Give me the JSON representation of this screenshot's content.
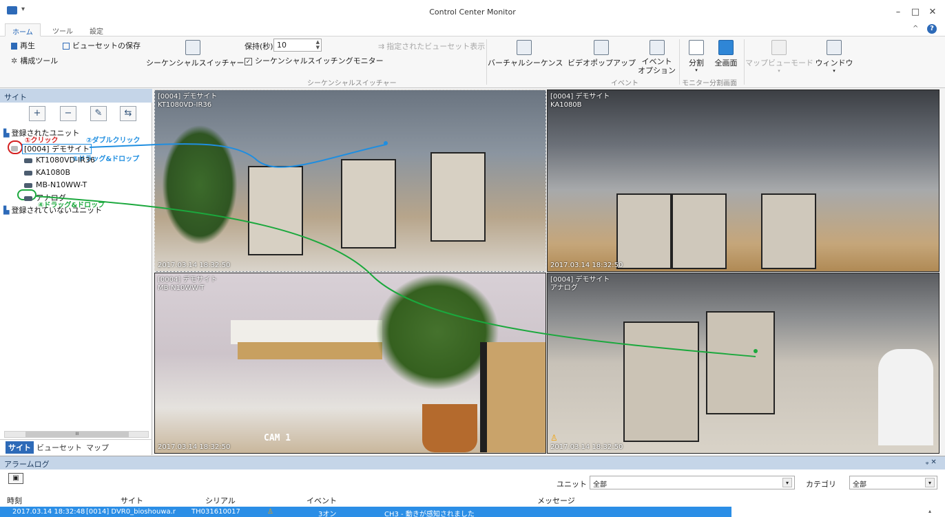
{
  "window": {
    "title": "Control Center Monitor",
    "minimize": "–",
    "maximize": "□",
    "close": "✕",
    "collapse": "^",
    "help": "?"
  },
  "tabs": [
    "ホーム",
    "ツール",
    "設定"
  ],
  "ribbon": {
    "play": "再生",
    "save_viewset": "ビューセットの保存",
    "config_tool": "構成ツール",
    "sequential_switcher": "シーケンシャルスイッチャー",
    "hold_label": "保持(秒)",
    "hold_value": "10",
    "seq_monitor": "シーケンシャルスイッチングモニター",
    "show_viewset": "指定されたビューセット表示",
    "group_seq": "シーケンシャルスイッチャー",
    "virtual_sequence": "バーチャルシーケンス",
    "video_popup": "ビデオポップアップ",
    "event_option_1": "イベント",
    "event_option_2": "オプション",
    "group_event": "イベント",
    "split": "分割",
    "fullscreen": "全画面",
    "group_monitor": "モニター分割画面",
    "map_view": "マップビューモード",
    "window": "ウィンドウ"
  },
  "left": {
    "header": "サイト",
    "tree_root": "登録されたユニット",
    "site_node": "[0004] デモサイト",
    "cameras": [
      "KT1080VD-IR36",
      "KA1080B",
      "MB-N10WW-T",
      "アナログ"
    ],
    "unregistered": "登録されていないユニット",
    "annotations": {
      "click": "①クリック",
      "double_click": "②ダブルクリック",
      "drag_drop_3": "③ドラッグ&ドロップ",
      "drag_drop_4": "④ドラッグ&ドロップ"
    },
    "bottom_tabs": [
      "サイト",
      "ビューセット",
      "マップ"
    ],
    "scroll_marker": "III"
  },
  "videos": [
    {
      "site": "[0004] デモサイト",
      "cam": "KT1080VD-IR36",
      "time": "2017.03.14 18:32:50"
    },
    {
      "site": "[0004] デモサイト",
      "cam": "KA1080B",
      "time": "2017.03.14 18:32:50"
    },
    {
      "site": "[0004] デモサイト",
      "cam": "MB-N10WW-T",
      "time": "2017.03.14 18:32:50",
      "overlay": "CAM 1"
    },
    {
      "site": "[0004] デモサイト",
      "cam": "アナログ",
      "time": "2017.03.14 18:32:50"
    }
  ],
  "alarm": {
    "header": "アラームログ",
    "pin": "ᵩ ✕",
    "unit_label": "ユニット",
    "unit_value": "全部",
    "category_label": "カテゴリ",
    "category_value": "全部",
    "columns": [
      "時刻",
      "サイト",
      "シリアル",
      "イベント",
      "メッセージ"
    ],
    "rows": [
      {
        "time": "2017.03.14 18:32:48",
        "site": "[0014] DVR0_bioshouwa.r",
        "serial": "TH031610017",
        "event": "3オン",
        "message": "CH3 - 動きが感知されました"
      }
    ]
  },
  "colors": {
    "accent": "#1a5fb4",
    "selection": "#2b8ee6",
    "panel_header": "#c5d5e8",
    "annotation_blue": "#1f8ee0",
    "annotation_green": "#1ba83d",
    "annotation_red": "#d32020"
  }
}
